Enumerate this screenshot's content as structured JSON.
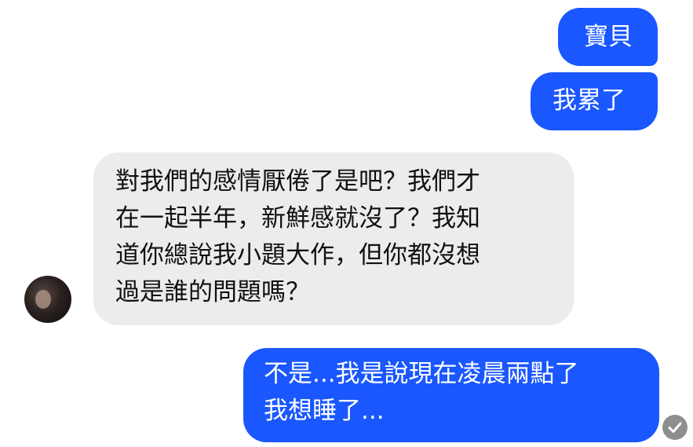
{
  "colors": {
    "outgoing_bubble": "#1a57ff",
    "incoming_bubble": "#ececec",
    "read_receipt": "#8e8e8e"
  },
  "messages": [
    {
      "sender": "me",
      "lines": [
        "寶貝"
      ]
    },
    {
      "sender": "me",
      "lines": [
        "我累了"
      ]
    },
    {
      "sender": "other",
      "lines": [
        "對我們的感情厭倦了是吧？我們才",
        "在一起半年，新鮮感就沒了？我知",
        "道你總說我小題大作，但你都沒想",
        "過是誰的問題嗎？"
      ]
    },
    {
      "sender": "me",
      "lines": [
        "不是...我是說現在凌晨兩點了",
        "我想睡了..."
      ]
    }
  ],
  "icons": {
    "avatar": "contact-avatar-photo",
    "read_receipt": "check-circle-icon"
  }
}
